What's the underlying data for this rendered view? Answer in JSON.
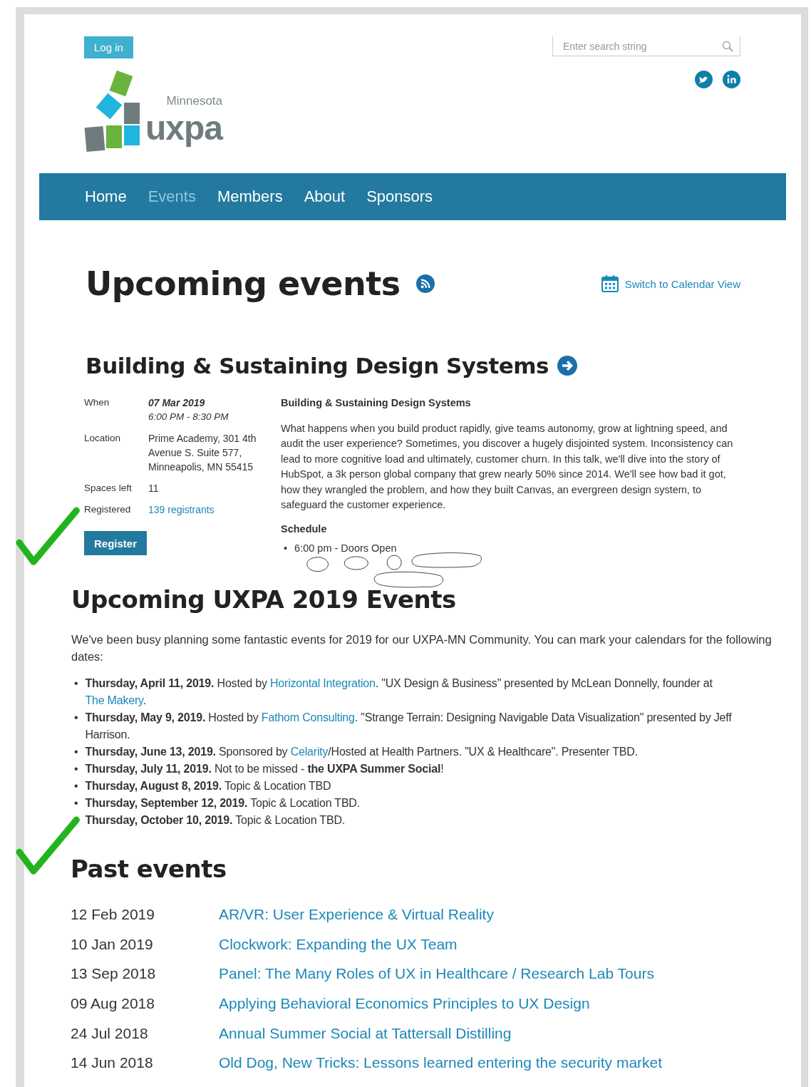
{
  "header": {
    "login_button": "Log in",
    "search": {
      "placeholder": "Enter search string"
    },
    "logo": {
      "region": "Minnesota",
      "wordmark": "uxpa"
    }
  },
  "nav": [
    {
      "label": "Home",
      "selected": false
    },
    {
      "label": "Events",
      "selected": true
    },
    {
      "label": "Members",
      "selected": false
    },
    {
      "label": "About",
      "selected": false
    },
    {
      "label": "Sponsors",
      "selected": false
    }
  ],
  "page_title": "Upcoming events",
  "calendar_link": "Switch to Calendar View",
  "featured_event": {
    "title": "Building & Sustaining Design Systems",
    "details": [
      {
        "label": "When",
        "kind": "when",
        "date": "07 Mar 2019",
        "time": "6:00 PM - 8:30 PM"
      },
      {
        "label": "Location",
        "kind": "plain",
        "value": "Prime Academy, 301 4th Avenue S. Suite 577, Minneapolis, MN 55415"
      },
      {
        "label": "Spaces left",
        "kind": "plain",
        "value": "11"
      },
      {
        "label": "Registered",
        "kind": "link",
        "value": "139 registrants"
      }
    ],
    "register_button": "Register",
    "description_title": "Building & Sustaining Design Systems",
    "description": "What happens when you build product rapidly, give teams autonomy, grow at lightning speed, and audit the user experience? Sometimes, you discover a hugely disjointed system. Inconsistency can lead to more cognitive load and ultimately, customer churn. In this talk, we'll dive into the story of HubSpot, a 3k person global company that grew nearly 50% since 2014. We'll see how bad it got, how they wrangled the problem, and how they built Canvas, an evergreen design system, to safeguard the customer experience.",
    "schedule_title": "Schedule",
    "marker": "•",
    "schedule": [
      "6:00 pm - Doors Open"
    ]
  },
  "upcoming": {
    "title": "Upcoming UXPA 2019 Events",
    "marker": "•",
    "intro": "We've been busy planning some fantastic events for 2019 for our UXPA-MN Community. You can mark your calendars for the following dates:",
    "items": [
      [
        {
          "kind": "bold",
          "text": "Thursday, April 11, 2019."
        },
        {
          "kind": "plain",
          "text": " Hosted by "
        },
        {
          "kind": "link",
          "text": "Horizontal Integration"
        },
        {
          "kind": "plain",
          "text": ". \"UX Design & Business\" presented by McLean Donnelly, founder at "
        },
        {
          "kind": "link",
          "text": "The Makery"
        },
        {
          "kind": "plain",
          "text": "."
        }
      ],
      [
        {
          "kind": "bold",
          "text": "Thursday, May 9, 2019."
        },
        {
          "kind": "plain",
          "text": " Hosted by "
        },
        {
          "kind": "link",
          "text": "Fathom Consulting"
        },
        {
          "kind": "plain",
          "text": ". \"Strange Terrain: Designing Navigable Data Visualization\" presented by Jeff Harrison."
        }
      ],
      [
        {
          "kind": "bold",
          "text": "Thursday, June 13, 2019."
        },
        {
          "kind": "plain",
          "text": " Sponsored by "
        },
        {
          "kind": "link",
          "text": "Celarity"
        },
        {
          "kind": "plain",
          "text": "/Hosted at Health Partners. \"UX & Healthcare\". Presenter TBD."
        }
      ],
      [
        {
          "kind": "bold",
          "text": "Thursday, July 11, 2019."
        },
        {
          "kind": "plain",
          "text": " Not to be missed - "
        },
        {
          "kind": "bold",
          "text": "the UXPA Summer Social"
        },
        {
          "kind": "plain",
          "text": "!"
        }
      ],
      [
        {
          "kind": "bold",
          "text": "Thursday, August 8, 2019."
        },
        {
          "kind": "plain",
          "text": " Topic & Location TBD"
        }
      ],
      [
        {
          "kind": "bold",
          "text": "Thursday, September 12, 2019."
        },
        {
          "kind": "plain",
          "text": " Topic & Location TBD."
        }
      ],
      [
        {
          "kind": "bold",
          "text": "Thursday, October 10, 2019."
        },
        {
          "kind": "plain",
          "text": " Topic & Location TBD."
        }
      ]
    ]
  },
  "past": {
    "title": "Past events",
    "rows": [
      {
        "date": "12 Feb 2019",
        "title": "AR/VR: User Experience & Virtual Reality"
      },
      {
        "date": "10 Jan 2019",
        "title": "Clockwork: Expanding the UX Team"
      },
      {
        "date": "13 Sep 2018",
        "title": "Panel: The Many Roles of UX in Healthcare / Research Lab Tours"
      },
      {
        "date": "09 Aug 2018",
        "title": "Applying Behavioral Economics Principles to UX Design"
      },
      {
        "date": "24 Jul 2018",
        "title": "Annual Summer Social at Tattersall Distilling"
      },
      {
        "date": "14 Jun 2018",
        "title": "Old Dog, New Tricks: Lessons learned entering the security market"
      }
    ]
  }
}
